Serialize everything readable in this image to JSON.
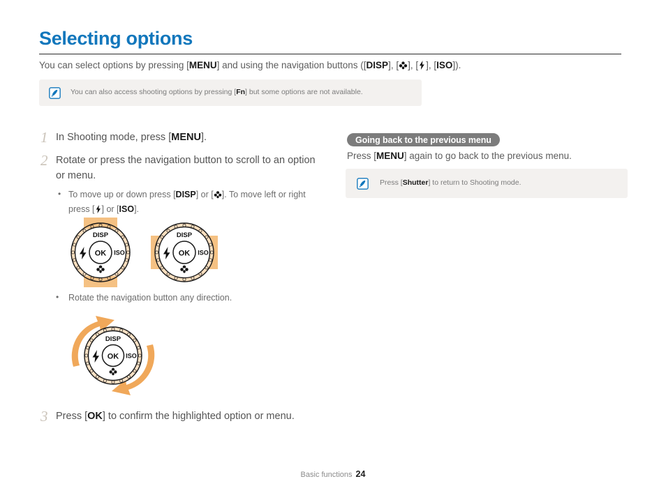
{
  "page": {
    "title": "Selecting options",
    "intro_prefix": "You can select options by pressing [",
    "intro_menu": "MENU",
    "intro_mid": "] and using the navigation buttons ([",
    "intro_disp": "DISP",
    "intro_sep1": "], [",
    "intro_macro_icon": "macro-flower-icon",
    "intro_sep2": "], [",
    "intro_flash_icon": "flash-bolt-icon",
    "intro_sep3": "], [",
    "intro_iso": "ISO",
    "intro_suffix": "]).",
    "title_color": "#1277bc"
  },
  "note_top": {
    "icon": "note-pen-icon",
    "text_before": "You can also access shooting options by pressing [",
    "key": "Fn",
    "text_after": "] but some options are not available."
  },
  "steps": [
    {
      "number": "1",
      "text_before": "In Shooting mode, press [",
      "key": "MENU",
      "text_after": "]."
    },
    {
      "number": "2",
      "text": "Rotate or press the navigation button to scroll to an option or menu.",
      "bullets": [
        {
          "p1": "To move up or down press [",
          "k1": "DISP",
          "p2": "] or [",
          "k2_icon": "macro-flower-icon",
          "p3": "]. To move left or right press [",
          "k3_icon": "flash-bolt-icon",
          "p4": "] or [",
          "k4": "ISO",
          "p5": "]."
        }
      ]
    },
    {
      "number": "3",
      "text_before": "Press [",
      "key": "OK",
      "text_after": "] to confirm the highlighted option or menu."
    }
  ],
  "rotate_bullet": "Rotate the navigation button any direction.",
  "right_column": {
    "heading": "Going back to the previous menu",
    "text_before": "Press [",
    "key": "MENU",
    "text_after": "] again to go back to the previous menu.",
    "note": {
      "icon": "note-pen-icon",
      "text_before": "Press [",
      "key": "Shutter",
      "text_after": "] to return to Shooting mode."
    }
  },
  "dials": {
    "labels": {
      "top": "DISP",
      "right": "ISO",
      "center": "OK",
      "left_icon": "flash-bolt-icon",
      "bottom_icon": "macro-flower-icon"
    },
    "highlight_color": "#f5c183",
    "items": [
      {
        "name": "dial-updown",
        "highlight": "vertical"
      },
      {
        "name": "dial-leftright",
        "highlight": "horizontal"
      },
      {
        "name": "dial-rotate",
        "highlight": "rotate-arrows"
      }
    ]
  },
  "footer": {
    "section": "Basic functions",
    "page_number": "24"
  }
}
